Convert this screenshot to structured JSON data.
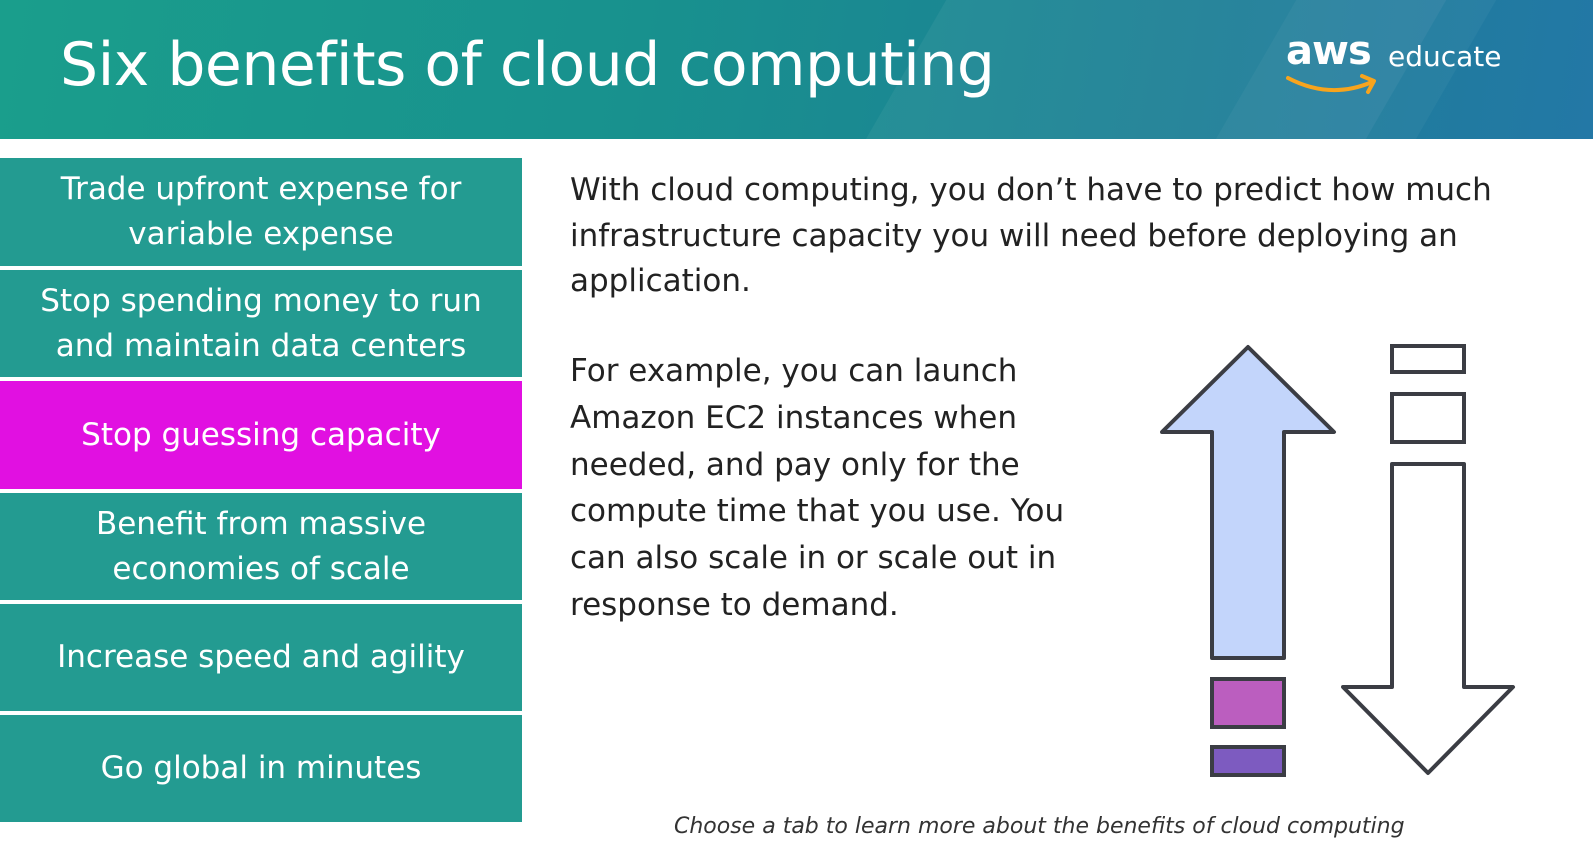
{
  "header": {
    "title": "Six benefits of cloud computing",
    "logo": {
      "brand": "aws",
      "product": "educate",
      "smile_color": "#f7a41d"
    },
    "background_colors": [
      "#1a9e8c",
      "#2378a6"
    ]
  },
  "tabs": [
    {
      "label": "Trade upfront expense for variable expense",
      "active": false
    },
    {
      "label": "Stop spending money to run and maintain data centers",
      "active": false
    },
    {
      "label": "Stop guessing capacity",
      "active": true
    },
    {
      "label": "Benefit from massive economies of scale",
      "active": false
    },
    {
      "label": "Increase speed and agility",
      "active": false
    },
    {
      "label": "Go global in minutes",
      "active": false
    }
  ],
  "tab_colors": {
    "default": "#239b91",
    "active": "#e110e1",
    "text": "#ffffff"
  },
  "content": {
    "paragraph1": "With cloud computing, you don’t have to predict how much infrastructure capacity you will need before deploying an application.",
    "paragraph2": "For example, you can launch Amazon EC2 instances when needed, and pay only for the compute time that you use. You can also scale in or scale out in response to demand."
  },
  "illustration": {
    "icons": [
      "scale-out-arrow-up-icon",
      "scale-in-arrow-down-icon"
    ],
    "colors": {
      "up_arrow_fill": "#c3d5fb",
      "outline": "#3b3d44",
      "block_magenta": "#bb5ebf",
      "block_purple": "#7d5bc0"
    }
  },
  "footer": {
    "caption": "Choose a tab to learn more about the benefits of cloud computing"
  }
}
